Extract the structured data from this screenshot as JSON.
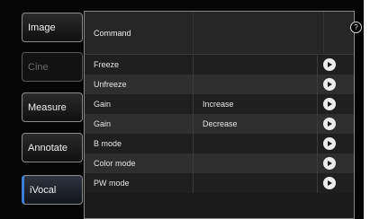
{
  "sidebar": {
    "items": [
      {
        "label": "Image",
        "state": "normal"
      },
      {
        "label": "Cine",
        "state": "disabled"
      },
      {
        "label": "Measure",
        "state": "normal"
      },
      {
        "label": "Annotate",
        "state": "normal"
      },
      {
        "label": "iVocal",
        "state": "selected"
      }
    ]
  },
  "help": {
    "glyph": "?"
  },
  "table": {
    "header": {
      "command_label": "Command"
    },
    "rows": [
      {
        "command": "Freeze",
        "parameter": ""
      },
      {
        "command": "Unfreeze",
        "parameter": ""
      },
      {
        "command": "Gain",
        "parameter": "Increase"
      },
      {
        "command": "Gain",
        "parameter": "Decrease"
      },
      {
        "command": "B mode",
        "parameter": ""
      },
      {
        "command": "Color mode",
        "parameter": ""
      },
      {
        "command": "PW mode",
        "parameter": ""
      }
    ]
  },
  "colors": {
    "selected_accent": "#3b7fd6",
    "background": "#050505",
    "row_light": "#2e2e2e",
    "row_dark": "#1f1f1f"
  }
}
